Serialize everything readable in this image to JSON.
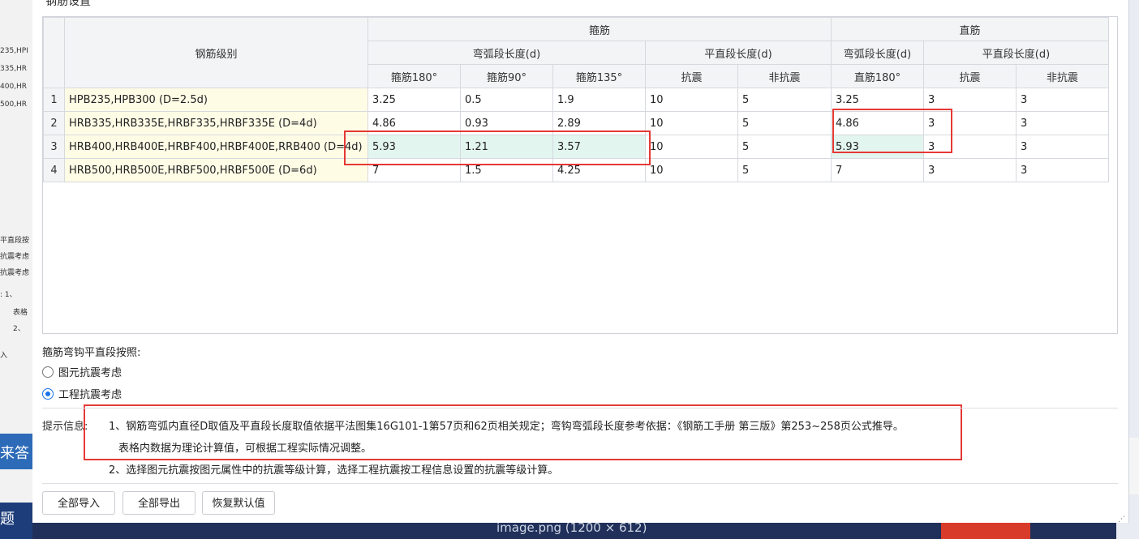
{
  "background": {
    "left_frags": [
      "235,HPI",
      "335,HR",
      "400,HR",
      "500,HR",
      "平直段按",
      "抗震考虑",
      "抗震考虑",
      ": 1、",
      "表格",
      "2、",
      "入"
    ],
    "left_blue_text": "来答",
    "left_dark_text": "题",
    "caption": "image.png (1200 × 612)"
  },
  "dialog": {
    "title": "钢筋设置"
  },
  "table": {
    "grade_header": "钢筋级别",
    "group_stirrup": "箍筋",
    "group_straight": "直筋",
    "sub_bend_len": "弯弧段长度(d)",
    "sub_flat_len": "平直段长度(d)",
    "sub_bend_len2": "弯弧段长度(d)",
    "sub_flat_len2": "平直段长度(d)",
    "cols": [
      "箍筋180°",
      "箍筋90°",
      "箍筋135°",
      "抗震",
      "非抗震",
      "直筋180°",
      "抗震",
      "非抗震"
    ],
    "rows": [
      {
        "no": "1",
        "grade": "HPB235,HPB300 (D=2.5d)",
        "v": [
          "3.25",
          "0.5",
          "1.9",
          "10",
          "5",
          "3.25",
          "3",
          "3"
        ]
      },
      {
        "no": "2",
        "grade": "HRB335,HRB335E,HRBF335,HRBF335E (D=4d)",
        "v": [
          "4.86",
          "0.93",
          "2.89",
          "10",
          "5",
          "4.86",
          "3",
          "3"
        ]
      },
      {
        "no": "3",
        "grade": "HRB400,HRB400E,HRBF400,HRBF400E,RRB400 (D=4d)",
        "v": [
          "5.93",
          "1.21",
          "3.57",
          "10",
          "5",
          "5.93",
          "3",
          "3"
        ]
      },
      {
        "no": "4",
        "grade": "HRB500,HRB500E,HRBF500,HRBF500E (D=6d)",
        "v": [
          "7",
          "1.5",
          "4.25",
          "10",
          "5",
          "7",
          "3",
          "3"
        ]
      }
    ]
  },
  "options": {
    "label": "箍筋弯钩平直段按照:",
    "opt1": "图元抗震考虑",
    "opt2": "工程抗震考虑",
    "selected": "opt2"
  },
  "tips": {
    "label": "提示信息:",
    "line1": "1、钢筋弯弧内直径D取值及平直段长度取值依据平法图集16G101-1第57页和62页相关规定；弯钩弯弧段长度参考依据：《钢筋工手册  第三版》第253~258页公式推导。",
    "line2": "表格内数据为理论计算值，可根据工程实际情况调整。",
    "line3": "2、选择图元抗震按图元属性中的抗震等级计算，选择工程抗震按工程信息设置的抗震等级计算。"
  },
  "buttons": {
    "import_all": "全部导入",
    "export_all": "全部导出",
    "restore": "恢复默认值"
  },
  "colors": {
    "highlight": "#e53935",
    "selected_cell": "#e3f5ef",
    "grade_cell": "#fffce6",
    "radio_accent": "#1a73e8"
  }
}
